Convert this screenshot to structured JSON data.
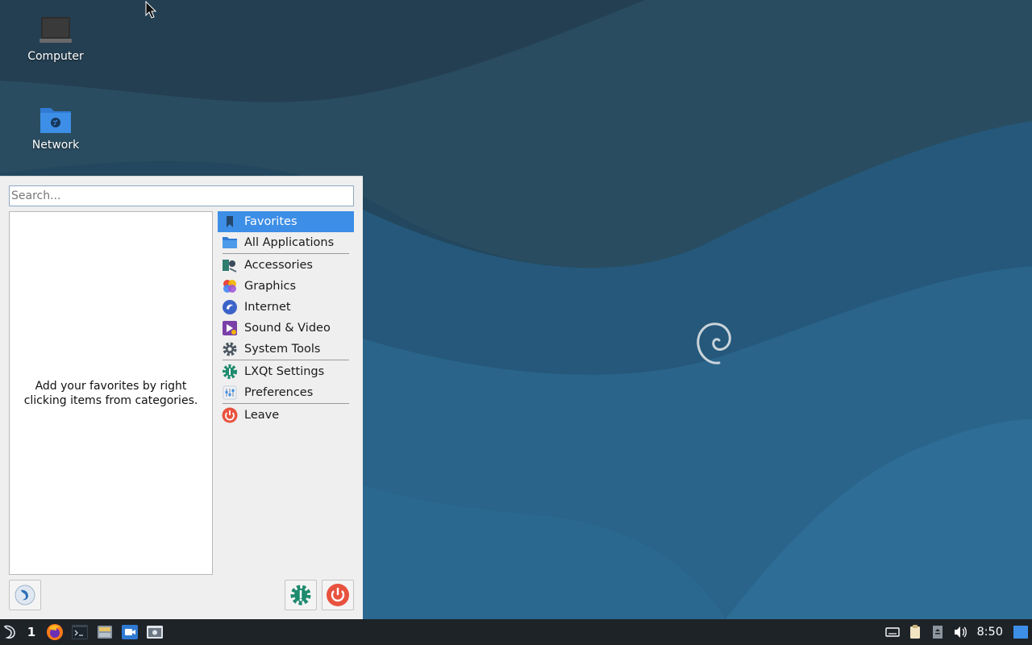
{
  "desktop": {
    "icons": [
      {
        "label": "Computer",
        "icon": "computer-icon"
      },
      {
        "label": "Network",
        "icon": "network-folder-icon"
      }
    ]
  },
  "menu": {
    "search_placeholder": "Search...",
    "favorites_hint": "Add your favorites by right clicking items from categories.",
    "categories": [
      {
        "label": "Favorites",
        "icon": "bookmark-icon",
        "selected": true
      },
      {
        "label": "All Applications",
        "icon": "folder-icon"
      },
      {
        "label": "Accessories",
        "icon": "accessories-icon"
      },
      {
        "label": "Graphics",
        "icon": "graphics-icon"
      },
      {
        "label": "Internet",
        "icon": "internet-icon"
      },
      {
        "label": "Sound & Video",
        "icon": "multimedia-icon"
      },
      {
        "label": "System Tools",
        "icon": "gear-icon"
      },
      {
        "label": "LXQt Settings",
        "icon": "lxqt-settings-icon"
      },
      {
        "label": "Preferences",
        "icon": "preferences-icon"
      },
      {
        "label": "Leave",
        "icon": "power-icon"
      }
    ]
  },
  "panel": {
    "desktop_number": "1",
    "launchers": [
      "firefox-icon",
      "terminal-icon",
      "file-manager-icon",
      "video-call-icon",
      "screenshot-icon"
    ],
    "tray": [
      "keyboard-icon",
      "clipboard-icon",
      "removable-media-icon",
      "volume-icon"
    ],
    "clock": "8:50"
  },
  "colors": {
    "selection": "#3d8ee6",
    "panel": "#1e2328",
    "wallpaper": "#204a63"
  }
}
